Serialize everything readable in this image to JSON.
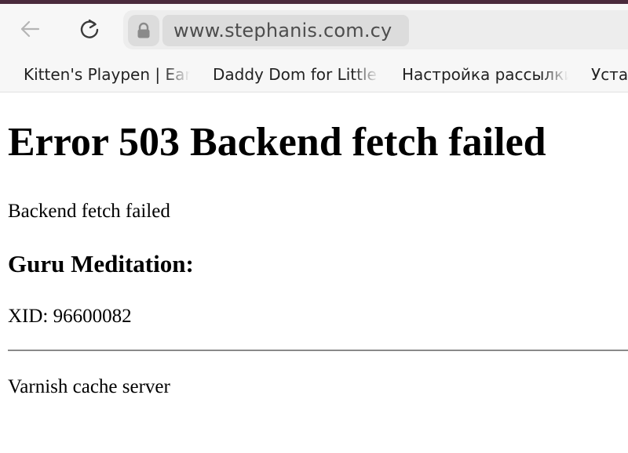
{
  "browser": {
    "address_bar": {
      "url": "www.stephanis.com.cy"
    },
    "bookmarks": [
      {
        "label": "Kitten's Playpen | Ear"
      },
      {
        "label": "Daddy Dom for Little"
      },
      {
        "label": "Настройка рассылки"
      },
      {
        "label": "Уста"
      }
    ],
    "icons": {
      "back": "back-arrow-icon",
      "reload": "reload-icon",
      "lock": "lock-icon"
    }
  },
  "page": {
    "title": "Error 503 Backend fetch failed",
    "description": "Backend fetch failed",
    "guru_heading": "Guru Meditation:",
    "xid": "XID: 96600082",
    "footer": "Varnish cache server"
  },
  "colors": {
    "top_strip": "#4a2a3c",
    "toolbar_bg": "#f7f7f7",
    "address_bg": "#ededed",
    "url_highlight": "#dcdcdc"
  }
}
